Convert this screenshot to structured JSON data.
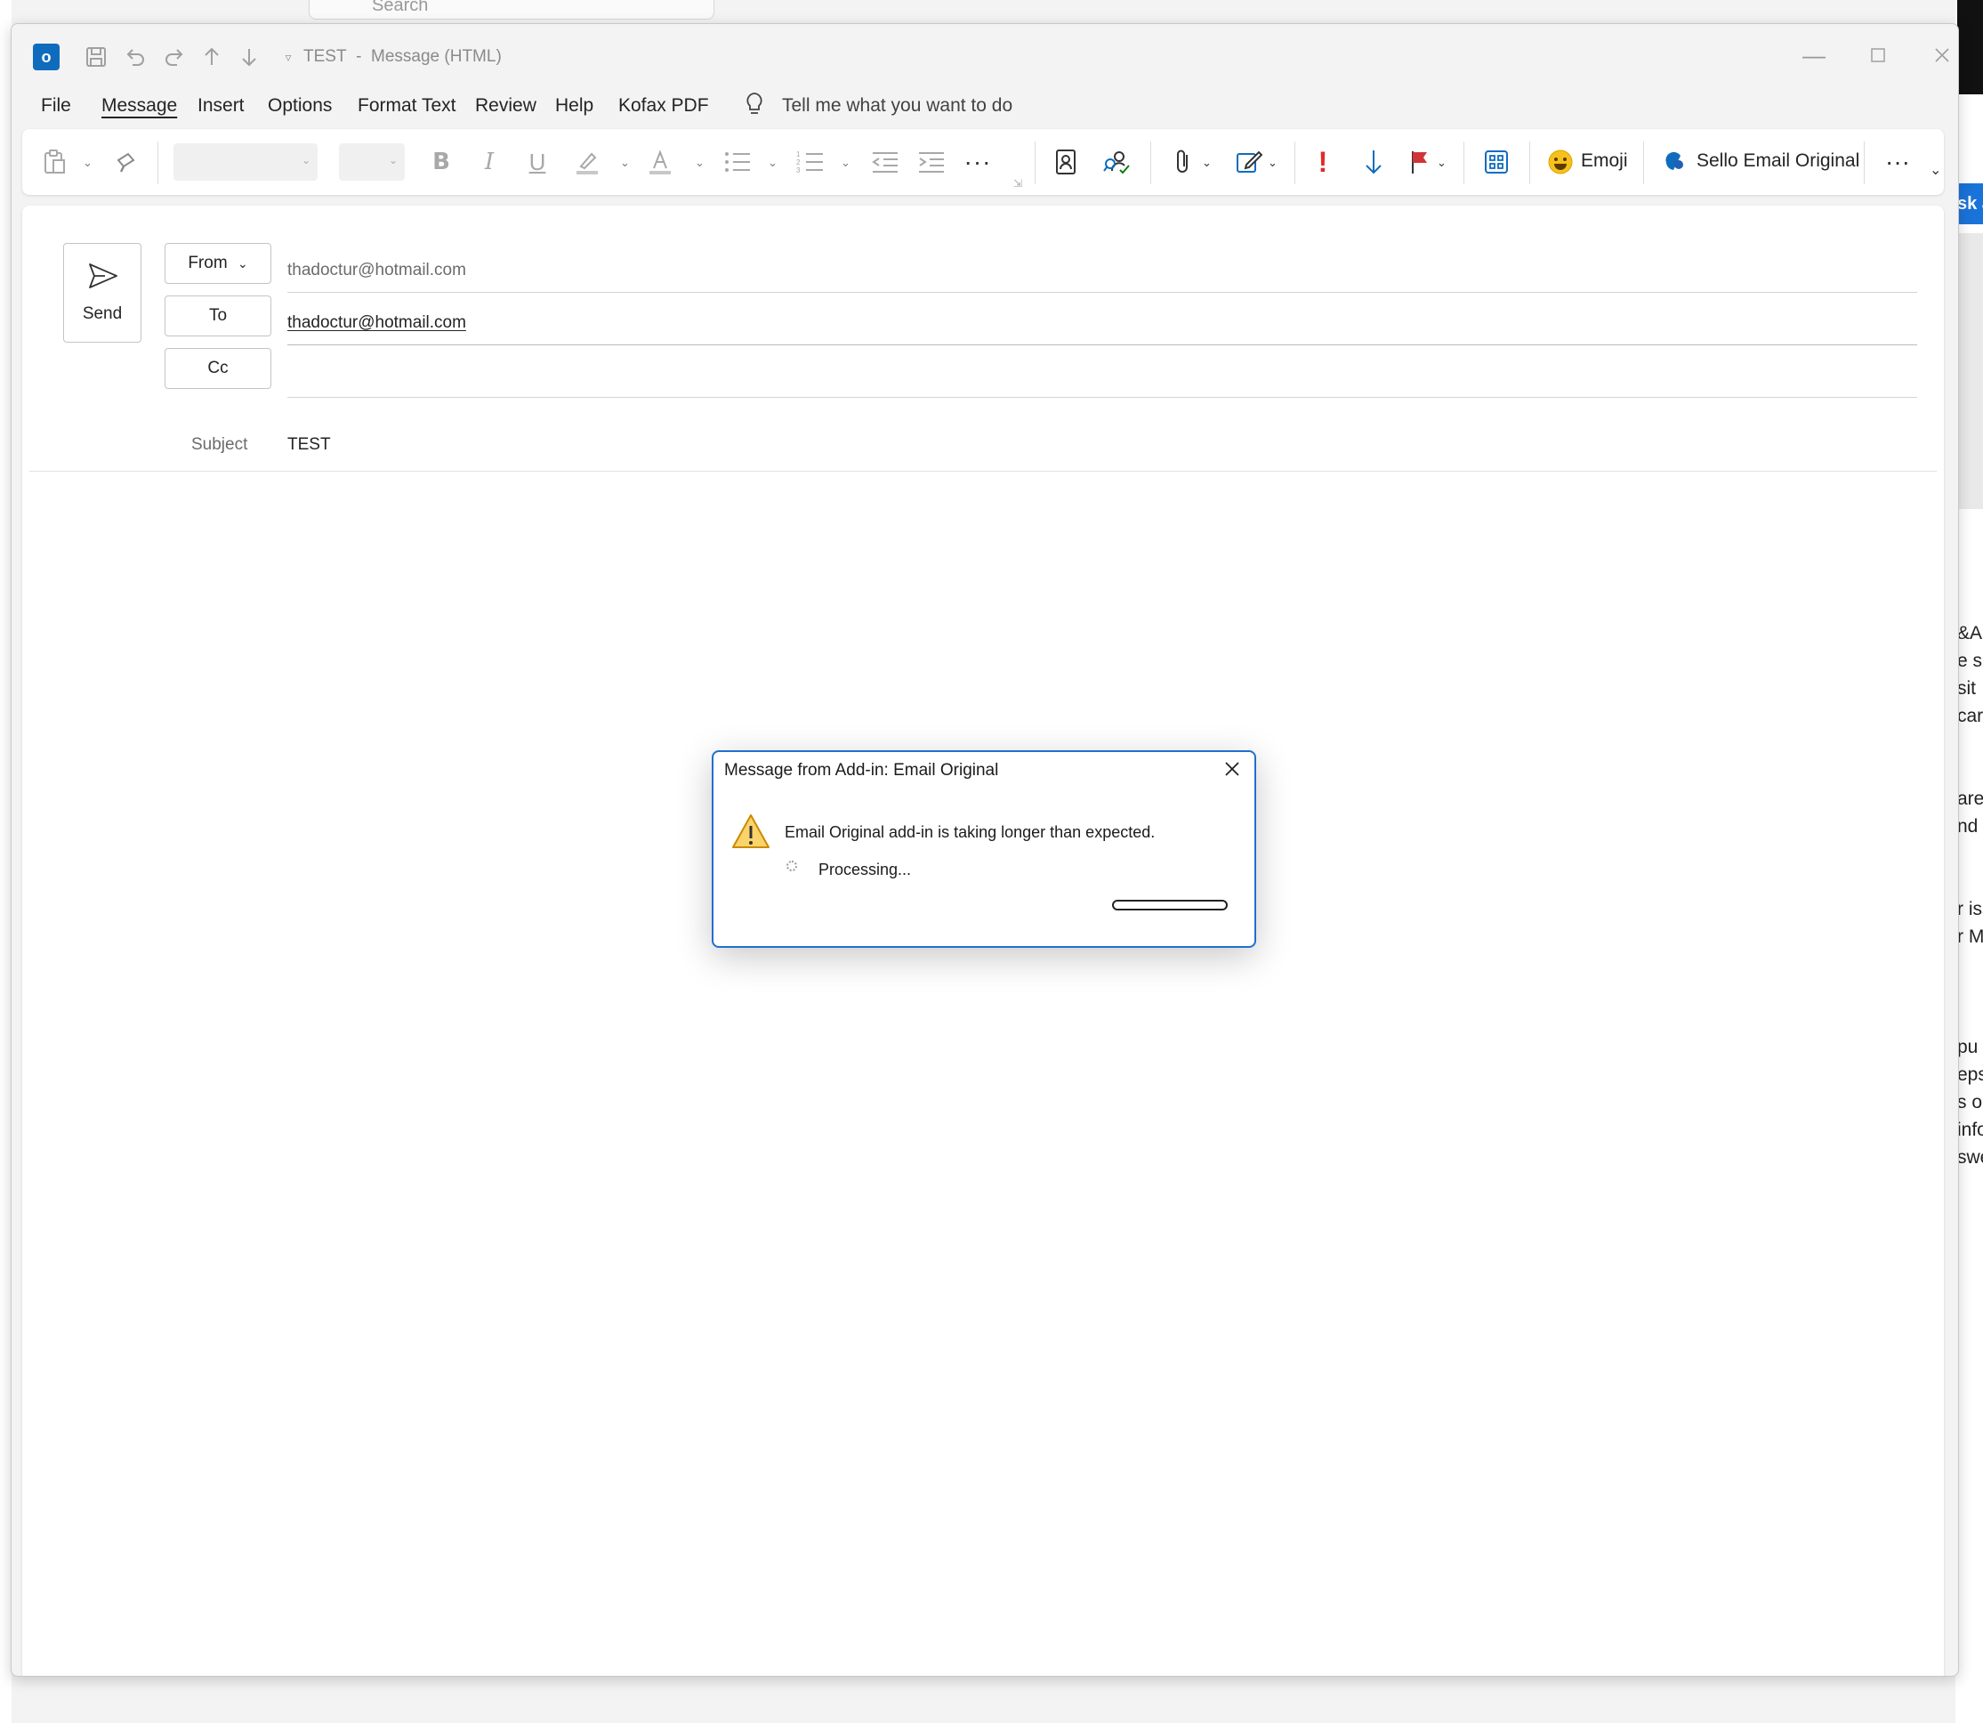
{
  "background": {
    "search_placeholder": "Search",
    "right_panel_button": "sk a",
    "right_panel_lines": [
      "&A",
      "e s",
      "sit",
      "car",
      "",
      "",
      "are",
      "nd",
      "",
      "",
      "r iss",
      "r M",
      "",
      "",
      "",
      "pu",
      "eps",
      "s o",
      "info",
      "swe"
    ]
  },
  "window": {
    "title": "TEST",
    "title_separator": "-",
    "title_suffix": "Message (HTML)"
  },
  "menu": {
    "items": [
      "File",
      "Message",
      "Insert",
      "Options",
      "Format Text",
      "Review",
      "Help",
      "Kofax PDF"
    ],
    "active": "Message",
    "tell_me": "Tell me what you want to do"
  },
  "ribbon": {
    "emoji_label": "Emoji",
    "sello_label": "Sello Email Original"
  },
  "compose": {
    "send_label": "Send",
    "from_label": "From",
    "from_value": "thadoctur@hotmail.com",
    "to_label": "To",
    "to_value": "thadoctur@hotmail.com",
    "cc_label": "Cc",
    "cc_value": "",
    "subject_label": "Subject",
    "subject_value": "TEST"
  },
  "dialog": {
    "title": "Message from Add-in: Email Original",
    "message": "Email Original add-in is taking longer than expected.",
    "status": "Processing...",
    "progress": 0
  },
  "colors": {
    "accent": "#0f6cbd",
    "dialog_border": "#1f6fd1",
    "importance_high": "#e02b2b",
    "importance_low": "#0f6cbd",
    "flag": "#d13438",
    "warning": "#f2b01e"
  }
}
